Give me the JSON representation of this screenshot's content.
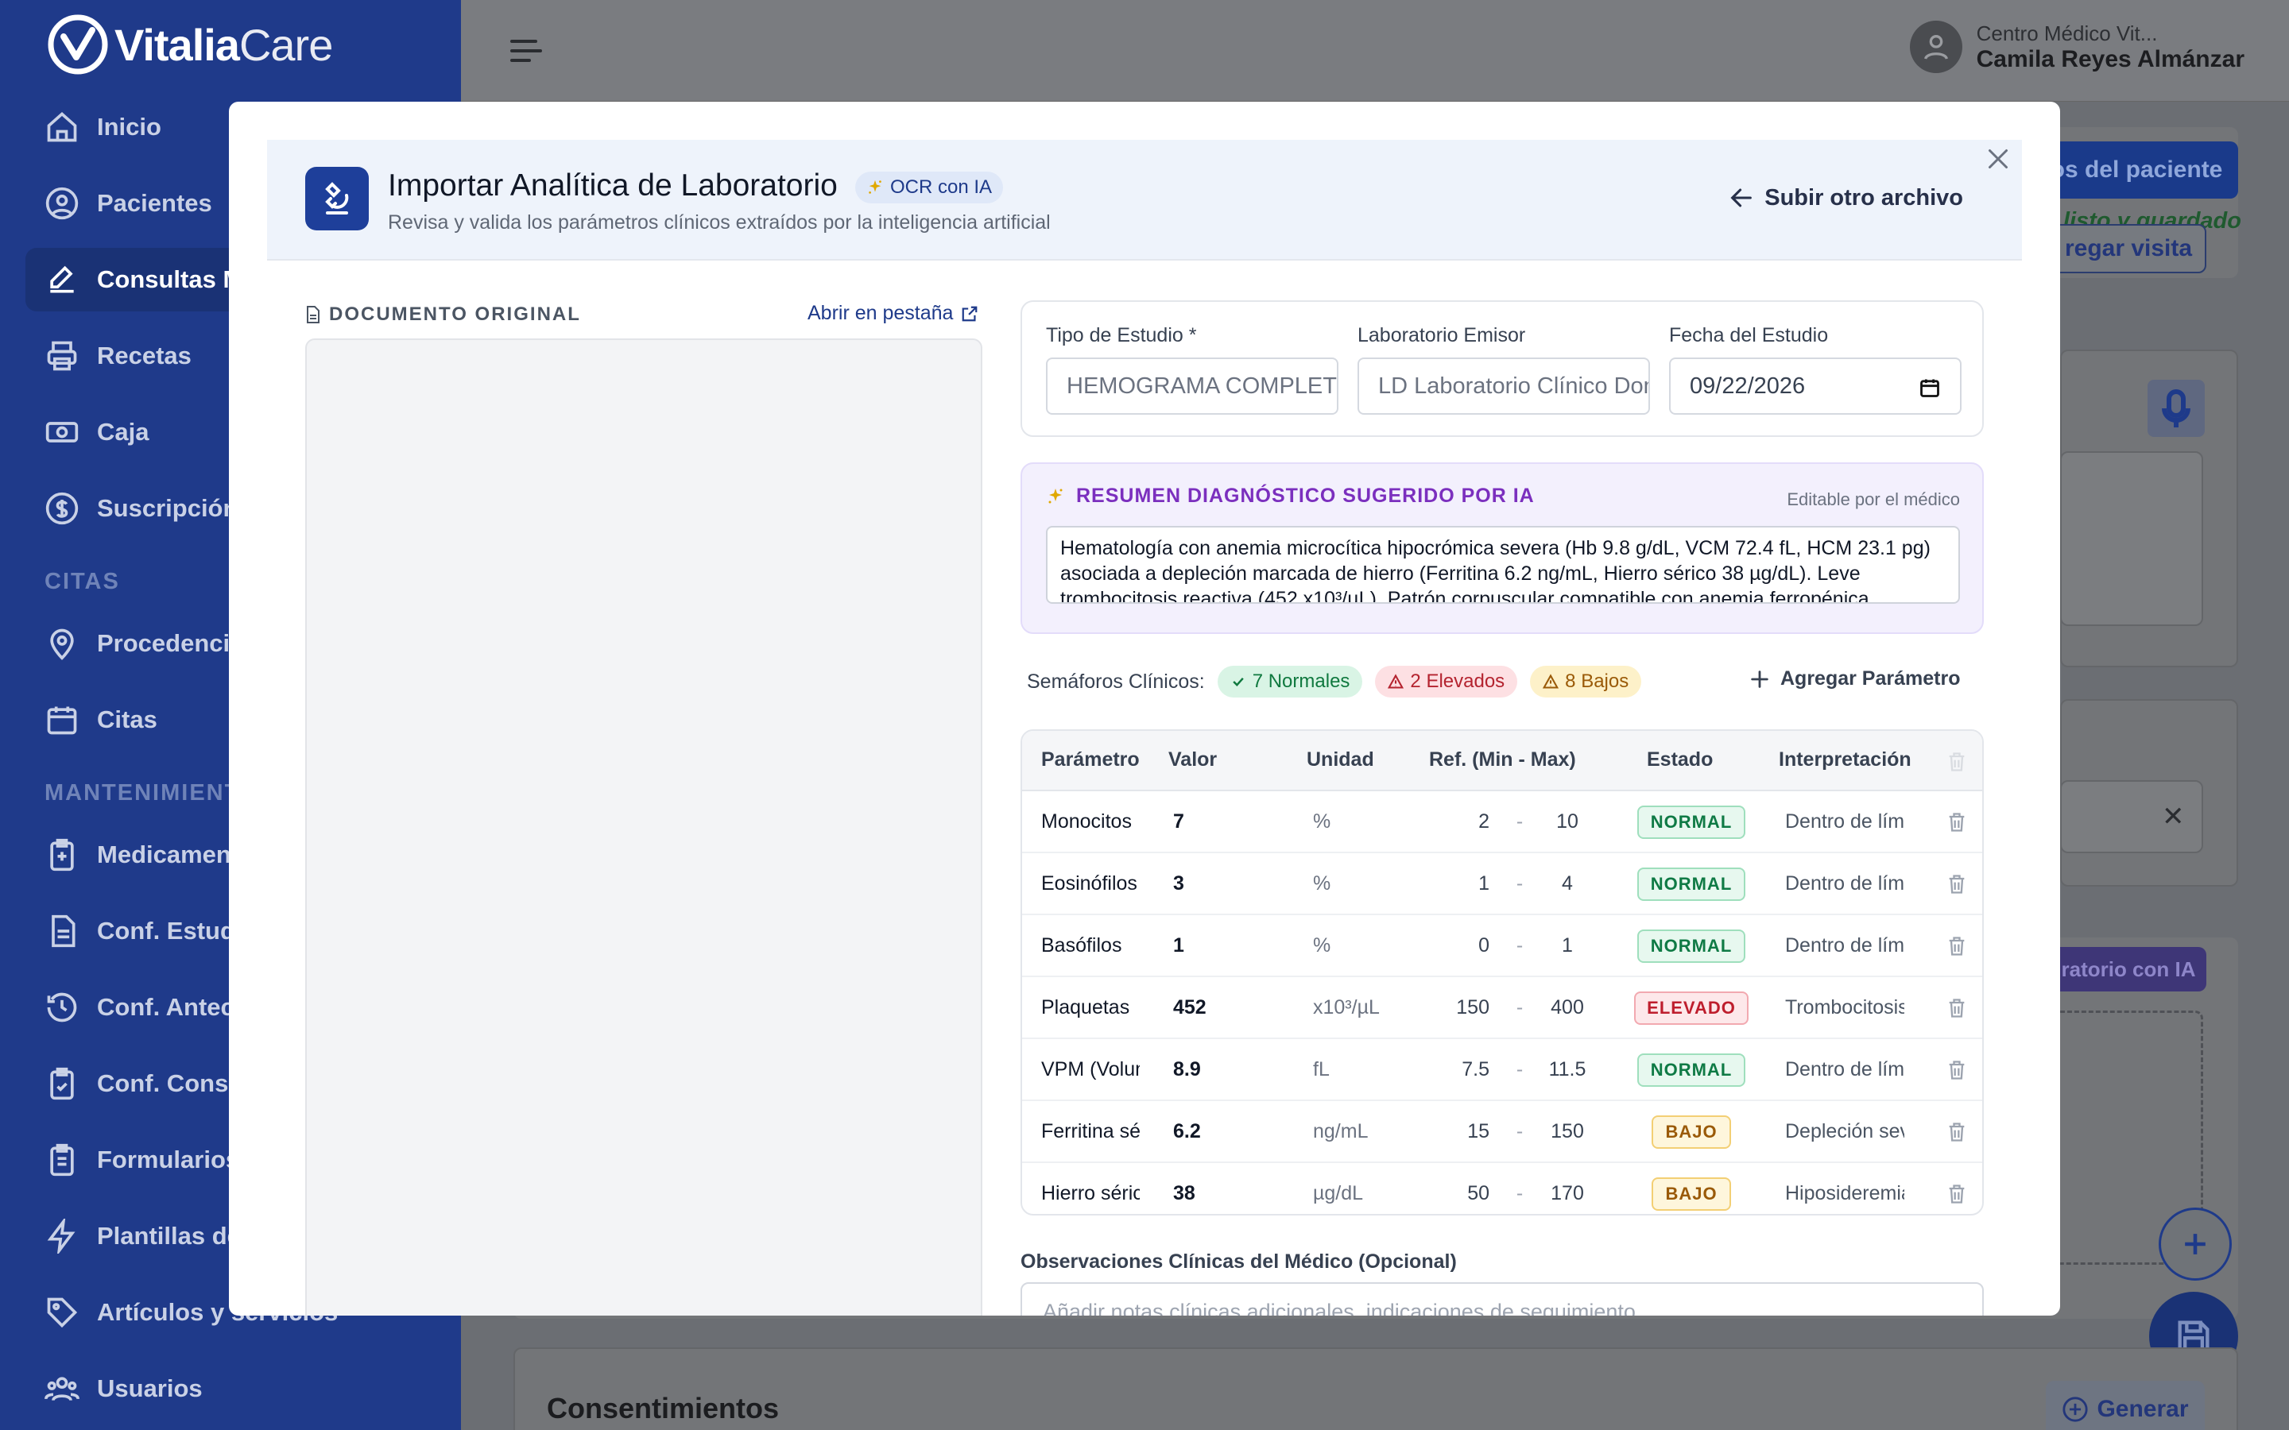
{
  "brand": {
    "name_bold": "Vitalia",
    "name_light": "Care"
  },
  "sidebar": {
    "items": [
      {
        "label": "Inicio"
      },
      {
        "label": "Pacientes"
      },
      {
        "label": "Consultas M"
      },
      {
        "label": "Recetas"
      },
      {
        "label": "Caja"
      },
      {
        "label": "Suscripción"
      }
    ],
    "section_citas": "CITAS",
    "citas_items": [
      {
        "label": "Procedencia"
      },
      {
        "label": "Citas"
      }
    ],
    "section_mant": "MANTENIMIENTO",
    "mant_items": [
      {
        "label": "Medicament"
      },
      {
        "label": "Conf. Estudi"
      },
      {
        "label": "Conf. Antece"
      },
      {
        "label": "Conf. Conse"
      },
      {
        "label": "Formularios"
      },
      {
        "label": "Plantillas de"
      },
      {
        "label": "Artículos y servicios"
      },
      {
        "label": "Usuarios"
      }
    ]
  },
  "user": {
    "center": "Centro Médico Vit...",
    "name": "Camila Reyes Almánzar"
  },
  "background": {
    "patient_btn": "os del paciente",
    "saved_text": "listo y guardado",
    "add_visit": "regar visita",
    "lab_ai_btn": "ratorio con IA",
    "consents_title": "Consentimientos",
    "generate_btn": "Generar"
  },
  "modal": {
    "title": "Importar Analítica de Laboratorio",
    "badge": "OCR con IA",
    "subtitle": "Revisa y valida los parámetros clínicos extraídos por la inteligencia artificial",
    "back_link": "Subir otro archivo",
    "doc_label": "DOCUMENTO ORIGINAL",
    "open_tab": "Abrir en pestaña",
    "fields": {
      "tipo_label": "Tipo de Estudio *",
      "tipo_value": "HEMOGRAMA COMPLETO",
      "lab_label": "Laboratorio Emisor",
      "lab_value": "LD Laboratorio Clínico Dominicano",
      "fecha_label": "Fecha del Estudio",
      "fecha_value": "09/22/2026"
    },
    "ai_summary": {
      "title": "RESUMEN DIAGNÓSTICO SUGERIDO POR IA",
      "editable": "Editable por el médico",
      "text": "Hematología con anemia microcítica hipocrómica severa (Hb 9.8 g/dL, VCM 72.4 fL, HCM 23.1 pg) asociada a depleción marcada de hierro (Ferritina 6.2 ng/mL, Hierro sérico 38 µg/dL). Leve trombocitosis reactiva (452 x10³/µL). Patrón corpuscular compatible con anemia ferropénica."
    },
    "semaforos": {
      "label": "Semáforos Clínicos:",
      "normal": "7 Normales",
      "elevated": "2 Elevados",
      "low": "8 Bajos",
      "add_param": "Agregar Parámetro"
    },
    "table": {
      "headers": [
        "Parámetro",
        "Valor",
        "Unidad",
        "Ref. (Min - Max)",
        "Estado",
        "Interpretación"
      ],
      "rows": [
        {
          "param": "Monocitos",
          "value": "7",
          "unit": "%",
          "min": "2",
          "sep": "-",
          "max": "10",
          "status": "NORMAL",
          "interp": "Dentro de límites"
        },
        {
          "param": "Eosinófilos",
          "value": "3",
          "unit": "%",
          "min": "1",
          "sep": "-",
          "max": "4",
          "status": "NORMAL",
          "interp": "Dentro de límites"
        },
        {
          "param": "Basófilos",
          "value": "1",
          "unit": "%",
          "min": "0",
          "sep": "-",
          "max": "1",
          "status": "NORMAL",
          "interp": "Dentro de límites"
        },
        {
          "param": "Plaquetas",
          "value": "452",
          "unit": "x10³/µL",
          "min": "150",
          "sep": "-",
          "max": "400",
          "status": "ELEVADO",
          "interp": "Trombocitosis"
        },
        {
          "param": "VPM (Volumen",
          "value": "8.9",
          "unit": "fL",
          "min": "7.5",
          "sep": "-",
          "max": "11.5",
          "status": "NORMAL",
          "interp": "Dentro de límites"
        },
        {
          "param": "Ferritina sérica",
          "value": "6.2",
          "unit": "ng/mL",
          "min": "15",
          "sep": "-",
          "max": "150",
          "status": "BAJO",
          "interp": "Depleción severa"
        },
        {
          "param": "Hierro sérico",
          "value": "38",
          "unit": "µg/dL",
          "min": "50",
          "sep": "-",
          "max": "170",
          "status": "BAJO",
          "interp": "Hiposideremia"
        }
      ]
    },
    "observations": {
      "label": "Observaciones Clínicas del Médico (Opcional)",
      "placeholder": "Añadir notas clínicas adicionales, indicaciones de seguimiento..."
    }
  },
  "colors": {
    "primary": "#1e3f9a",
    "sidebar": "#1f3a8a",
    "ai_purple": "#7b2fbe"
  }
}
